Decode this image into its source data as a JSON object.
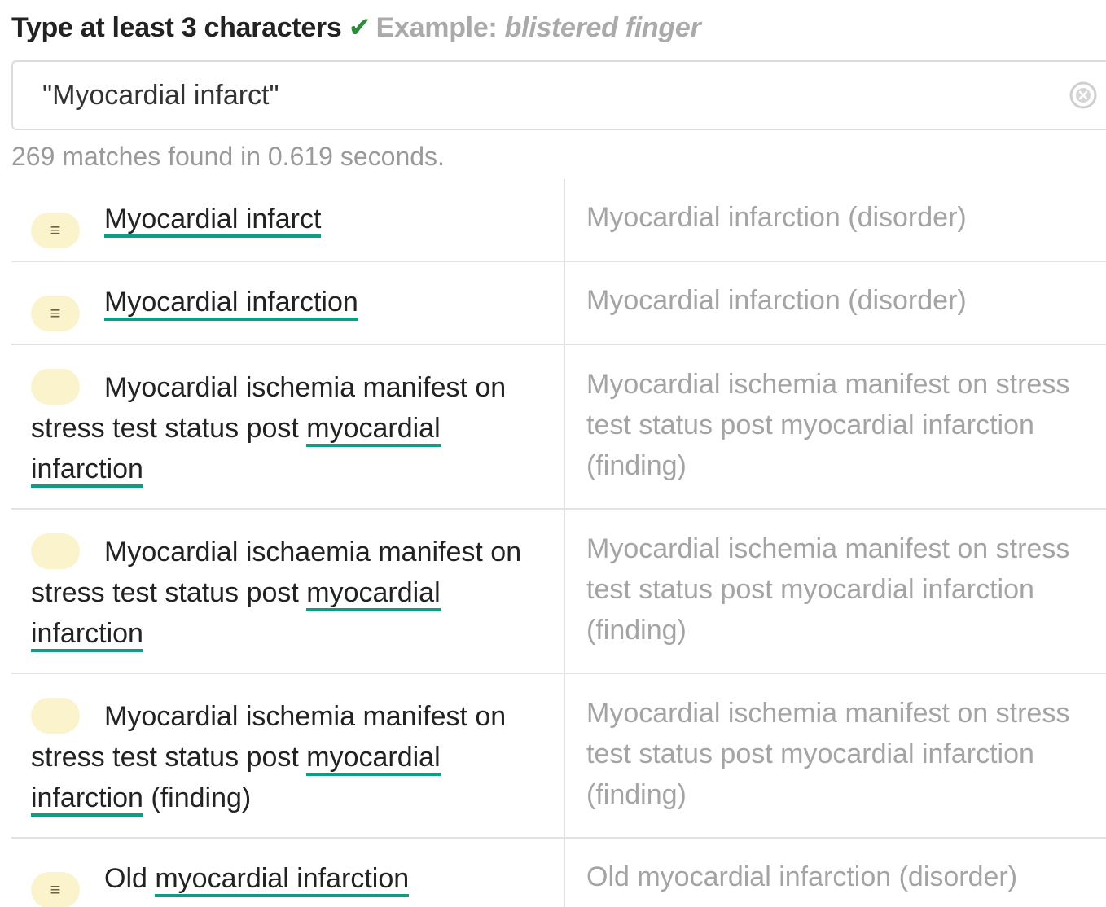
{
  "prompt": {
    "instruction": "Type at least 3 characters",
    "check": "✔",
    "example_label": "Example:",
    "example_value": "blistered finger"
  },
  "search": {
    "value": "\"Myocardial infarct\"",
    "placeholder": ""
  },
  "status": {
    "matches": "269 matches found in 0.619 seconds."
  },
  "results": [
    {
      "badge": "≡",
      "term_parts": [
        {
          "text": "Myocardial infarct",
          "hl": true
        }
      ],
      "concept": "Myocardial infarction (disorder)"
    },
    {
      "badge": "≡",
      "term_parts": [
        {
          "text": "Myocardial infarction",
          "hl": true
        }
      ],
      "concept": "Myocardial infarction (disorder)"
    },
    {
      "badge": "",
      "term_parts": [
        {
          "text": "Myocardial ischemia manifest on stress test status post ",
          "hl": false
        },
        {
          "text": "myocardial",
          "hl": true
        },
        {
          "text": " ",
          "hl": false
        },
        {
          "text": "infarction",
          "hl": true
        }
      ],
      "concept": "Myocardial ischemia manifest on stress test status post myocardial infarction (finding)"
    },
    {
      "badge": "",
      "term_parts": [
        {
          "text": "Myocardial ischaemia manifest on stress test status post ",
          "hl": false
        },
        {
          "text": "myocardial",
          "hl": true
        },
        {
          "text": " ",
          "hl": false
        },
        {
          "text": "infarction",
          "hl": true
        }
      ],
      "concept": "Myocardial ischemia manifest on stress test status post myocardial infarction (finding)"
    },
    {
      "badge": "",
      "term_parts": [
        {
          "text": "Myocardial ischemia manifest on stress test status post ",
          "hl": false
        },
        {
          "text": "myocardial",
          "hl": true
        },
        {
          "text": " ",
          "hl": false
        },
        {
          "text": "infarction",
          "hl": true
        },
        {
          "text": " (finding)",
          "hl": false
        }
      ],
      "concept": "Myocardial ischemia manifest on stress test status post myocardial infarction (finding)"
    },
    {
      "badge": "≡",
      "term_parts": [
        {
          "text": "Old ",
          "hl": false
        },
        {
          "text": "myocardial infarction",
          "hl": true
        }
      ],
      "concept": "Old myocardial infarction (disorder)"
    }
  ],
  "colors": {
    "highlight": "#0d9c84",
    "check": "#2e8b3e",
    "badge_bg": "#fbf3cc"
  },
  "icons": {
    "clear": "clear-circle-x-icon",
    "badge": "menu-lines-icon",
    "check": "checkmark-icon"
  }
}
